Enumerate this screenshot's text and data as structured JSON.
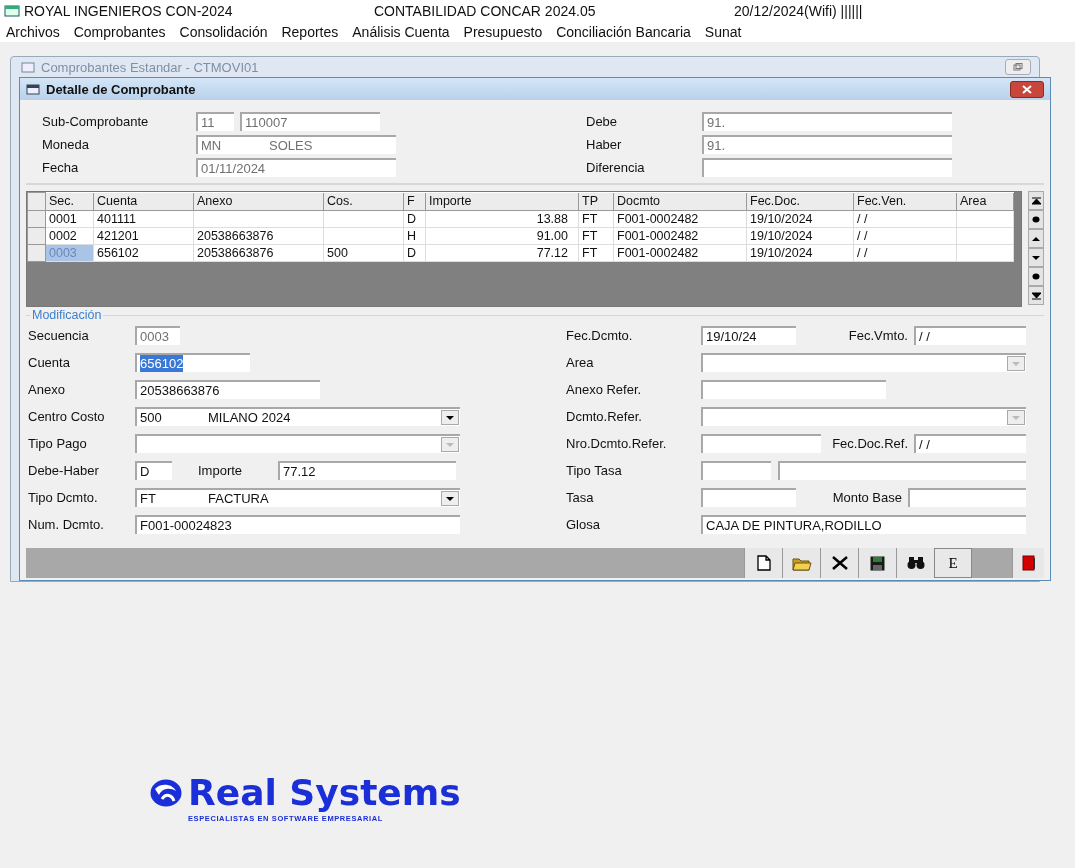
{
  "app_bar": {
    "company": "ROYAL INGENIEROS CON-2024",
    "product": "CONTABILIDAD CONCAR 2024.05",
    "date": "20/12/2024(Wifi) ||||||"
  },
  "menu": [
    "Archivos",
    "Comprobantes",
    "Consolidación",
    "Reportes",
    "Análisis Cuenta",
    "Presupuesto",
    "Conciliación Bancaria",
    "Sunat"
  ],
  "back_window": {
    "title": "Comprobantes Estandar - CTMOVI01"
  },
  "dialog": {
    "title": "Detalle de Comprobante"
  },
  "header_left": [
    {
      "label": "Sub-Comprobante",
      "fields": [
        {
          "value": "11",
          "disabled": true
        },
        {
          "value": "110007",
          "disabled": true
        }
      ]
    },
    {
      "label": "Moneda",
      "fields": [
        {
          "parts": [
            "MN",
            "SOLES"
          ],
          "disabled": true
        }
      ]
    },
    {
      "label": "Fecha",
      "fields": [
        {
          "value": "01/11/2024",
          "disabled": true
        }
      ]
    }
  ],
  "header_right": [
    {
      "label": "Debe",
      "value": "91.",
      "disabled": true
    },
    {
      "label": "Haber",
      "value": "91.",
      "disabled": true
    },
    {
      "label": "Diferencia"
    }
  ],
  "grid": {
    "columns": [
      "Sec.",
      "Cuenta",
      "Anexo",
      "Cos.",
      "F",
      "Importe",
      "TP",
      "Docmto",
      "Fec.Doc.",
      "Fec.Ven.",
      "Area"
    ],
    "rows": [
      {
        "cells": [
          "0001",
          "401111",
          null,
          null,
          "D",
          "13.88",
          "FT",
          "F001-0002482",
          "19/10/2024",
          "/ /",
          null
        ],
        "selected": false
      },
      {
        "cells": [
          "0002",
          "421201",
          "20538663876",
          null,
          "H",
          "91.00",
          "FT",
          "F001-0002482",
          "19/10/2024",
          "/ /",
          null
        ],
        "selected": false
      },
      {
        "cells": [
          "0003",
          "656102",
          "20538663876",
          "500",
          "D",
          "77.12",
          "FT",
          "F001-0002482",
          "19/10/2024",
          "/ /",
          null
        ],
        "selected": true
      }
    ]
  },
  "modificacion": {
    "title": "Modificación",
    "secuencia": {
      "label": "Secuencia",
      "value": "0003",
      "disabled": true
    },
    "cuenta": {
      "label": "Cuenta",
      "value": "656102",
      "selected": true
    },
    "anexo": {
      "label": "Anexo",
      "value": "20538663876"
    },
    "centro_costo": {
      "label": "Centro Costo",
      "parts": [
        "500",
        "MILANO 2024"
      ],
      "disabled": false
    },
    "tipo_pago": {
      "label": "Tipo Pago",
      "disabled": true
    },
    "debe_haber": {
      "label": "Debe-Haber",
      "value": "D"
    },
    "importe": {
      "label": "Importe",
      "value": "77.12"
    },
    "tipo_dcmto": {
      "label": "Tipo Dcmto.",
      "parts": [
        "FT",
        "FACTURA"
      ],
      "disabled": false
    },
    "num_dcmto": {
      "label": "Num. Dcmto.",
      "value": "F001-00024823"
    },
    "fec_dcmto": {
      "label": "Fec.Dcmto.",
      "value": "19/10/24"
    },
    "fec_vmto": {
      "label": "Fec.Vmto.",
      "value": "/ /"
    },
    "area": {
      "label": "Area",
      "disabled": true
    },
    "anexo_refer": {
      "label": "Anexo Refer."
    },
    "dcmto_refer": {
      "label": "Dcmto.Refer.",
      "disabled": true
    },
    "nro_dcmto_refer": {
      "label": "Nro.Dcmto.Refer."
    },
    "fec_doc_ref": {
      "label": "Fec.Doc.Ref.",
      "value": "/ /"
    },
    "tipo_tasa": {
      "label": "Tipo Tasa"
    },
    "tasa": {
      "label": "Tasa"
    },
    "monto_base": {
      "label": "Monto Base"
    },
    "glosa": {
      "label": "Glosa",
      "value": "CAJA DE PINTURA,RODILLO"
    }
  },
  "toolbar": [
    {
      "kind": "new"
    },
    {
      "kind": "open"
    },
    {
      "kind": "delete"
    },
    {
      "kind": "save"
    },
    {
      "kind": "find"
    },
    {
      "kind": "letter",
      "label": "E"
    },
    {
      "kind": "exit"
    }
  ],
  "logo": {
    "name": "Real Systems",
    "tagline": "ESPECIALISTAS EN SOFTWARE EMPRESARIAL"
  }
}
